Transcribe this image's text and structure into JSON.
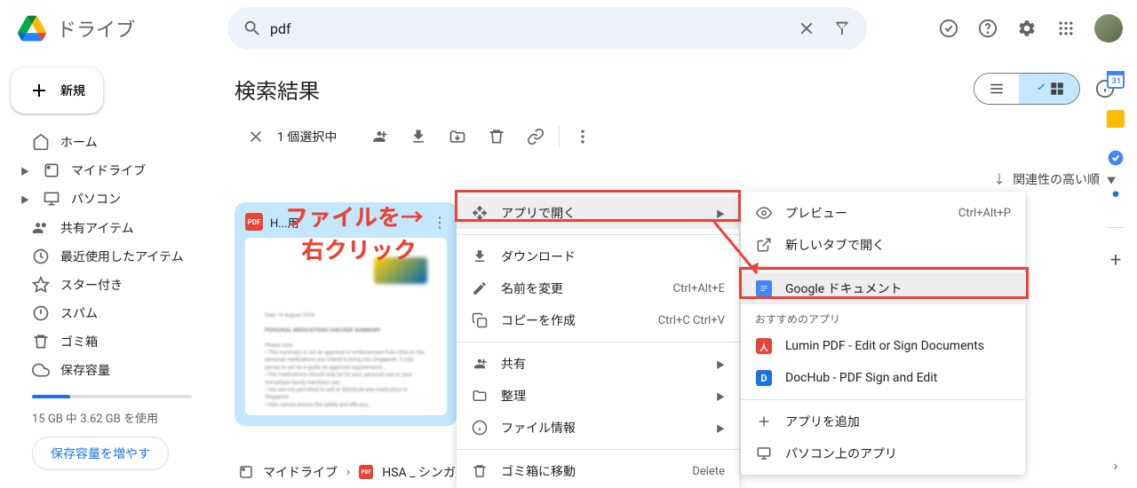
{
  "app": {
    "name": "ドライブ"
  },
  "search": {
    "value": "pdf"
  },
  "sidebar": {
    "new_label": "新規",
    "items": [
      {
        "label": "ホーム"
      },
      {
        "label": "マイドライブ"
      },
      {
        "label": "パソコン"
      },
      {
        "label": "共有アイテム"
      },
      {
        "label": "最近使用したアイテム"
      },
      {
        "label": "スター付き"
      },
      {
        "label": "スパム"
      },
      {
        "label": "ゴミ箱"
      },
      {
        "label": "保存容量"
      }
    ],
    "storage_text": "15 GB 中 3.62 GB を使用",
    "storage_btn": "保存容量を増やす"
  },
  "content": {
    "title": "検索結果",
    "selection_text": "1 個選択中",
    "sort_label": "関連性の高い順",
    "file": {
      "name": "HSA_シンガポール_薬_翻訳用"
    },
    "breadcrumb": {
      "root": "マイドライブ",
      "file": "HSA _ シンガ"
    }
  },
  "annotation": {
    "text1": "ファイルを→",
    "text2": "右クリック"
  },
  "context_menu": {
    "items": [
      {
        "label": "アプリで開く",
        "arrow": true
      },
      {
        "label": "ダウンロード"
      },
      {
        "label": "名前を変更",
        "shortcut": "Ctrl+Alt+E"
      },
      {
        "label": "コピーを作成",
        "shortcut": "Ctrl+C Ctrl+V"
      },
      {
        "label": "共有",
        "arrow": true
      },
      {
        "label": "整理",
        "arrow": true
      },
      {
        "label": "ファイル情報",
        "arrow": true
      },
      {
        "label": "ゴミ箱に移動",
        "shortcut": "Delete"
      }
    ]
  },
  "submenu": {
    "preview": {
      "label": "プレビュー",
      "shortcut": "Ctrl+Alt+P"
    },
    "newtab": {
      "label": "新しいタブで開く"
    },
    "gdocs": {
      "label": "Google ドキュメント"
    },
    "heading": "おすすめのアプリ",
    "lumin": {
      "label": "Lumin PDF - Edit or Sign Documents"
    },
    "dochub": {
      "label": "DocHub - PDF Sign and Edit"
    },
    "addapp": {
      "label": "アプリを追加"
    },
    "pcapp": {
      "label": "パソコン上のアプリ"
    }
  }
}
